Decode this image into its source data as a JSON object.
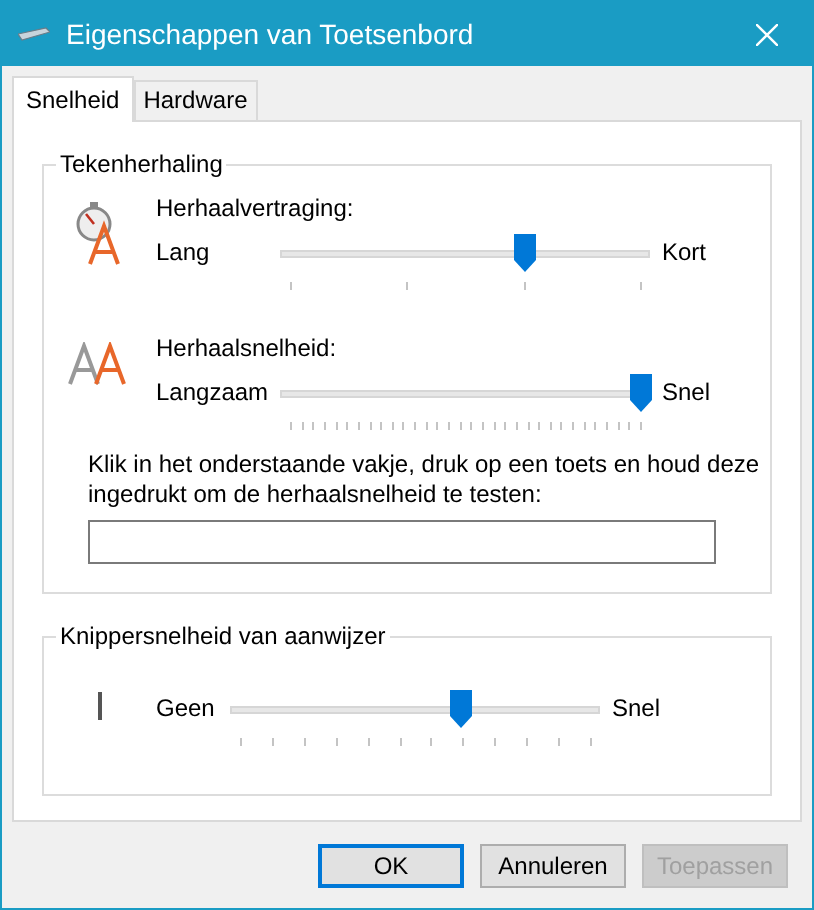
{
  "window": {
    "title": "Eigenschappen van Toetsenbord"
  },
  "tabs": [
    {
      "label": "Snelheid",
      "selected": true
    },
    {
      "label": "Hardware",
      "selected": false
    }
  ],
  "groups": [
    {
      "title": "Tekenherhaling",
      "settings": [
        {
          "kind": "delay",
          "label": "Herhaalvertraging:",
          "min_label": "Lang",
          "max_label": "Kort",
          "level": 0.667
        },
        {
          "kind": "rate",
          "label": "Herhaalsnelheid:",
          "min_label": "Langzaam",
          "max_label": "Snel",
          "level": 1
        }
      ],
      "instruction": "Klik in het onderstaande vakje, druk op een toets en houd deze ingedrukt om de herhaalsnelheid te testen:"
    },
    {
      "title": "Knippersnelheid van aanwijzer",
      "settings": [
        {
          "kind": "blink",
          "min_label": "Geen",
          "max_label": "Snel",
          "level": 0.63
        }
      ]
    }
  ],
  "buttons": [
    {
      "label": "OK",
      "default": true,
      "disabled": false
    },
    {
      "label": "Annuleren",
      "default": false,
      "disabled": false
    },
    {
      "label": "Toepassen",
      "default": false,
      "disabled": true
    }
  ]
}
